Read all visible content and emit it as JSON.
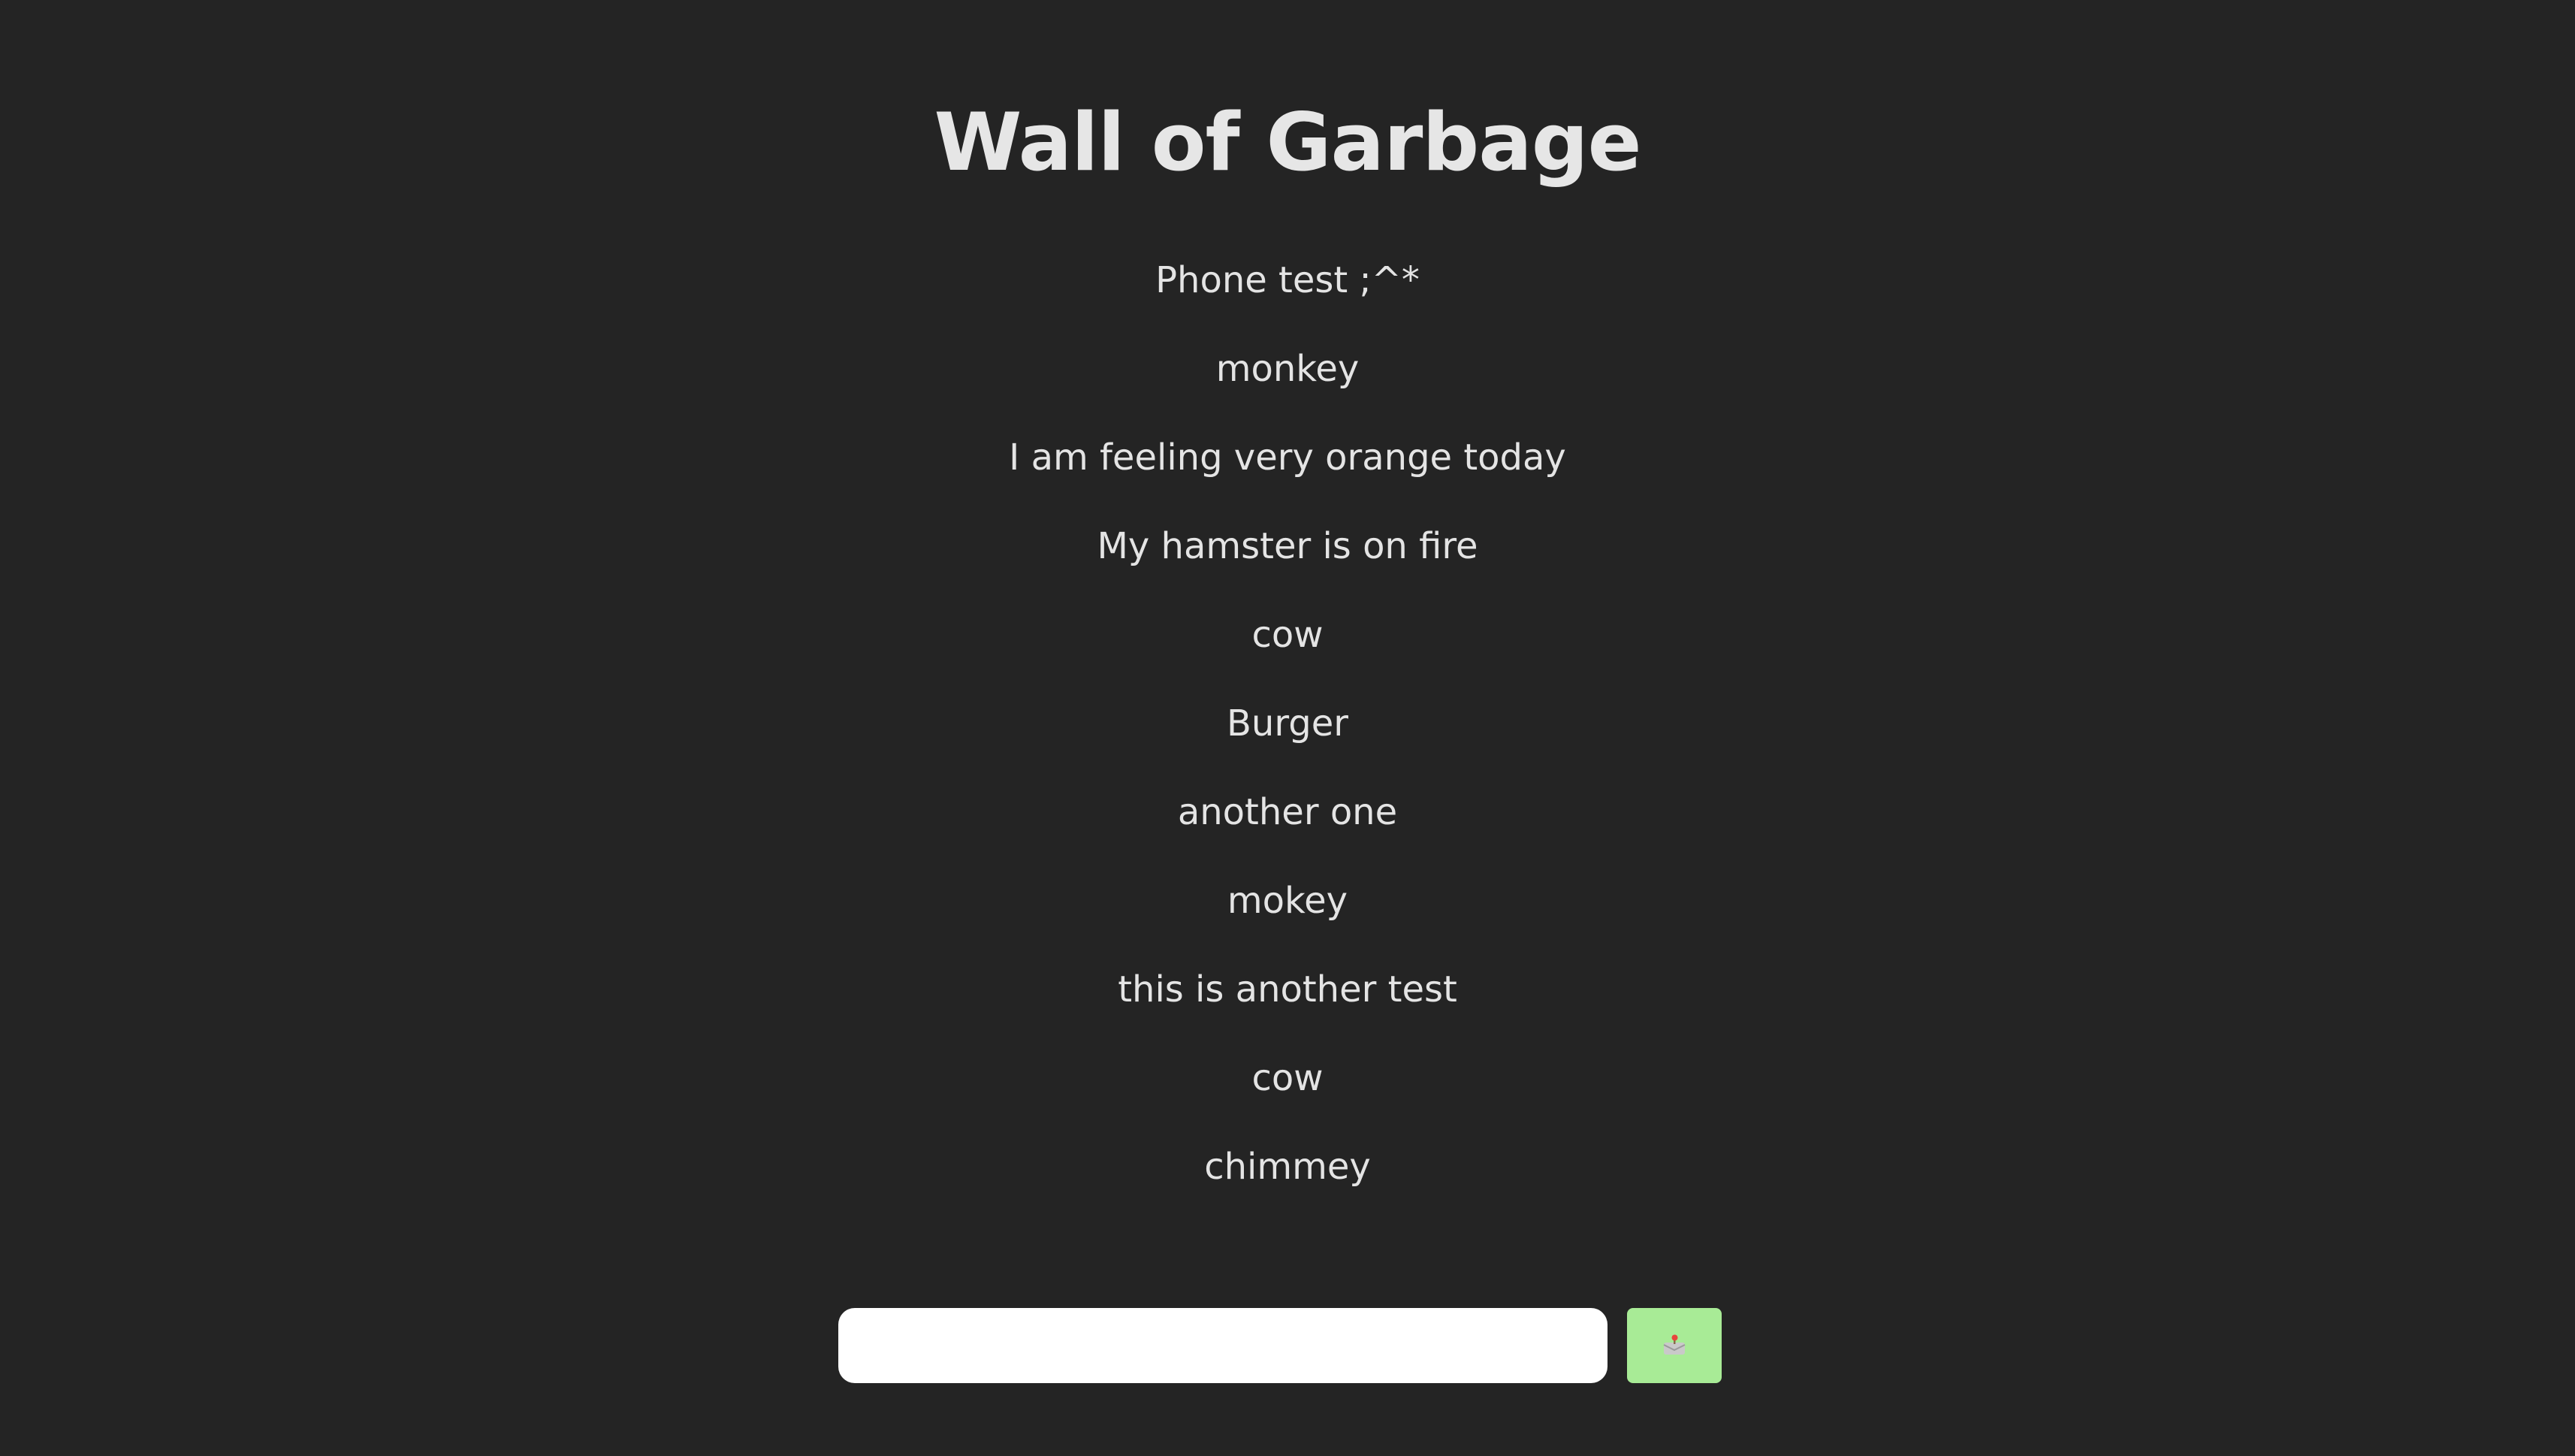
{
  "header": {
    "title": "Wall of Garbage"
  },
  "messages": [
    "Phone test ;^*",
    "monkey",
    "I am feeling very orange today",
    "My hamster is on fire",
    "cow",
    "Burger",
    "another one",
    "mokey",
    "this is another test",
    "cow",
    "chimmey"
  ],
  "composer": {
    "input_value": "",
    "input_placeholder": "",
    "send_icon": "mailbox-icon",
    "send_button_color": "#a8eb96"
  },
  "theme": {
    "background": "#242424",
    "text": "#ebebeb"
  }
}
